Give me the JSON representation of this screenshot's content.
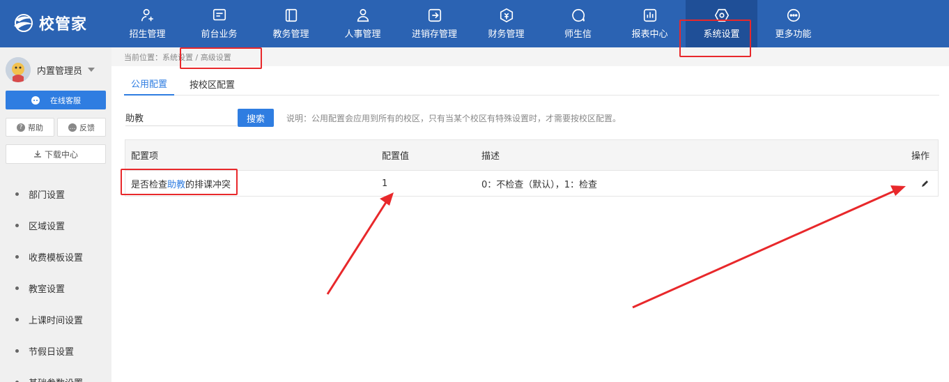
{
  "app": {
    "logo_text": "校管家"
  },
  "nav": [
    {
      "label": "招生管理",
      "icon": "user-plus-icon"
    },
    {
      "label": "前台业务",
      "icon": "monitor-icon"
    },
    {
      "label": "教务管理",
      "icon": "book-icon"
    },
    {
      "label": "人事管理",
      "icon": "person-icon"
    },
    {
      "label": "进销存管理",
      "icon": "inventory-icon"
    },
    {
      "label": "财务管理",
      "icon": "finance-icon"
    },
    {
      "label": "师生信",
      "icon": "chat-icon"
    },
    {
      "label": "报表中心",
      "icon": "report-icon"
    },
    {
      "label": "系统设置",
      "icon": "settings-icon",
      "active": true
    },
    {
      "label": "更多功能",
      "icon": "more-icon"
    }
  ],
  "sidebar": {
    "user_name": "内置管理员",
    "service_label": "在线客服",
    "help_label": "帮助",
    "feedback_label": "反馈",
    "download_label": "下载中心",
    "items": [
      {
        "label": "部门设置"
      },
      {
        "label": "区域设置"
      },
      {
        "label": "收费模板设置"
      },
      {
        "label": "教室设置"
      },
      {
        "label": "上课时间设置"
      },
      {
        "label": "节假日设置"
      },
      {
        "label": "基础参数设置"
      }
    ]
  },
  "breadcrumb": {
    "text": "当前位置：系统设置 / 高级设置"
  },
  "tabs": [
    {
      "label": "公用配置",
      "active": true
    },
    {
      "label": "按校区配置"
    }
  ],
  "search": {
    "value": "助教",
    "button_label": "搜索"
  },
  "note": "说明：公用配置会应用到所有的校区，只有当某个校区有特殊设置时，才需要按校区配置。",
  "table": {
    "headers": [
      "配置项",
      "配置值",
      "描述",
      "操作"
    ],
    "rows": [
      {
        "name_pre": "是否检查",
        "name_hl": "助教",
        "name_post": "的排课冲突",
        "value": "1",
        "desc": "0：不检查（默认），1：检查"
      }
    ]
  },
  "colors": {
    "nav_bg": "#2b63b3",
    "accent": "#2f7de1",
    "annotation": "#e8282b"
  }
}
